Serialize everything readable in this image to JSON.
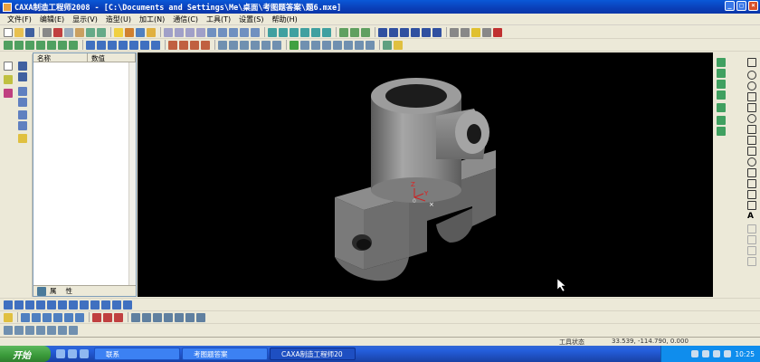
{
  "window": {
    "title": "CAXA制造工程师2008   - [C:\\Documents and Settings\\Me\\桌面\\考图题答案\\题6.mxe]"
  },
  "menu": [
    "文件(F)",
    "编辑(E)",
    "显示(V)",
    "造型(U)",
    "加工(N)",
    "通信(C)",
    "工具(T)",
    "设置(S)",
    "帮助(H)"
  ],
  "panel": {
    "columns": [
      "名称",
      "数值"
    ],
    "tabs": [
      "属",
      "性"
    ]
  },
  "viewport": {
    "axis_labels": {
      "z": "Z",
      "y": "Y",
      "origin": "0"
    }
  },
  "status": {
    "tool_state": "工具状态",
    "coordinates": "33.539, -114.790, 0.000"
  },
  "taskbar": {
    "start_label": "开始",
    "tasks": [
      "联系",
      "考图题答案",
      "CAXA制造工程师20"
    ],
    "clock": "10:25"
  },
  "colors": {
    "titlebar": "#0a4fd0",
    "viewport_bg": "#000000",
    "model_gray": "#8a8a8a"
  }
}
